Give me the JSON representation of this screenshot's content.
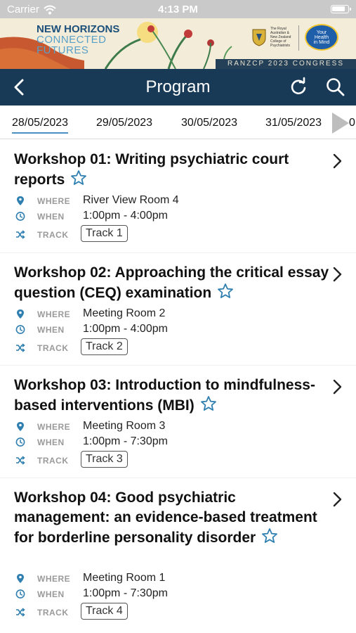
{
  "status_bar": {
    "carrier": "Carrier",
    "time": "4:13 PM",
    "wifi_icon": "wifi-icon",
    "battery_icon": "battery-icon"
  },
  "banner": {
    "tagline": [
      "NEW HORIZONS",
      "CONNECTED",
      "FUTURES"
    ],
    "college": [
      "The Royal",
      "Australian &",
      "New Zealand",
      "College of",
      "Psychiatrists"
    ],
    "your_health": [
      "Your",
      "Health",
      "in Mind"
    ],
    "congress": "RANZCP 2023 CONGRESS"
  },
  "navbar": {
    "title": "Program",
    "back_icon": "chevron-left-icon",
    "refresh_icon": "refresh-icon",
    "search_icon": "search-icon",
    "color": "#183a57"
  },
  "tabs": {
    "dates": [
      "28/05/2023",
      "29/05/2023",
      "30/05/2023",
      "31/05/2023"
    ],
    "active_index": 0,
    "clipped_next": "0",
    "accent": "#4a90c2"
  },
  "labels": {
    "where": "WHERE",
    "when": "WHEN",
    "track": "TRACK"
  },
  "sessions": [
    {
      "title": "Workshop 01: Writing psychiatric court reports",
      "where": "River View Room 4",
      "when": "1:00pm - 4:00pm",
      "track": "Track 1"
    },
    {
      "title": "Workshop 02: Approaching the critical essay question (CEQ) examination",
      "where": "Meeting Room 2",
      "when": "1:00pm - 4:00pm",
      "track": "Track 2"
    },
    {
      "title": "Workshop 03: Introduction to mindfulness-based interventions (MBI)",
      "where": "Meeting Room 3",
      "when": "1:00pm - 7:30pm",
      "track": "Track 3"
    },
    {
      "title": "Workshop 04: Good psychiatric management: an evidence-based treatment for borderline personality disorder",
      "where": "Meeting Room 1",
      "when": "1:00pm - 7:30pm",
      "track": "Track 4"
    }
  ],
  "icon_color": "#2f7fb0"
}
